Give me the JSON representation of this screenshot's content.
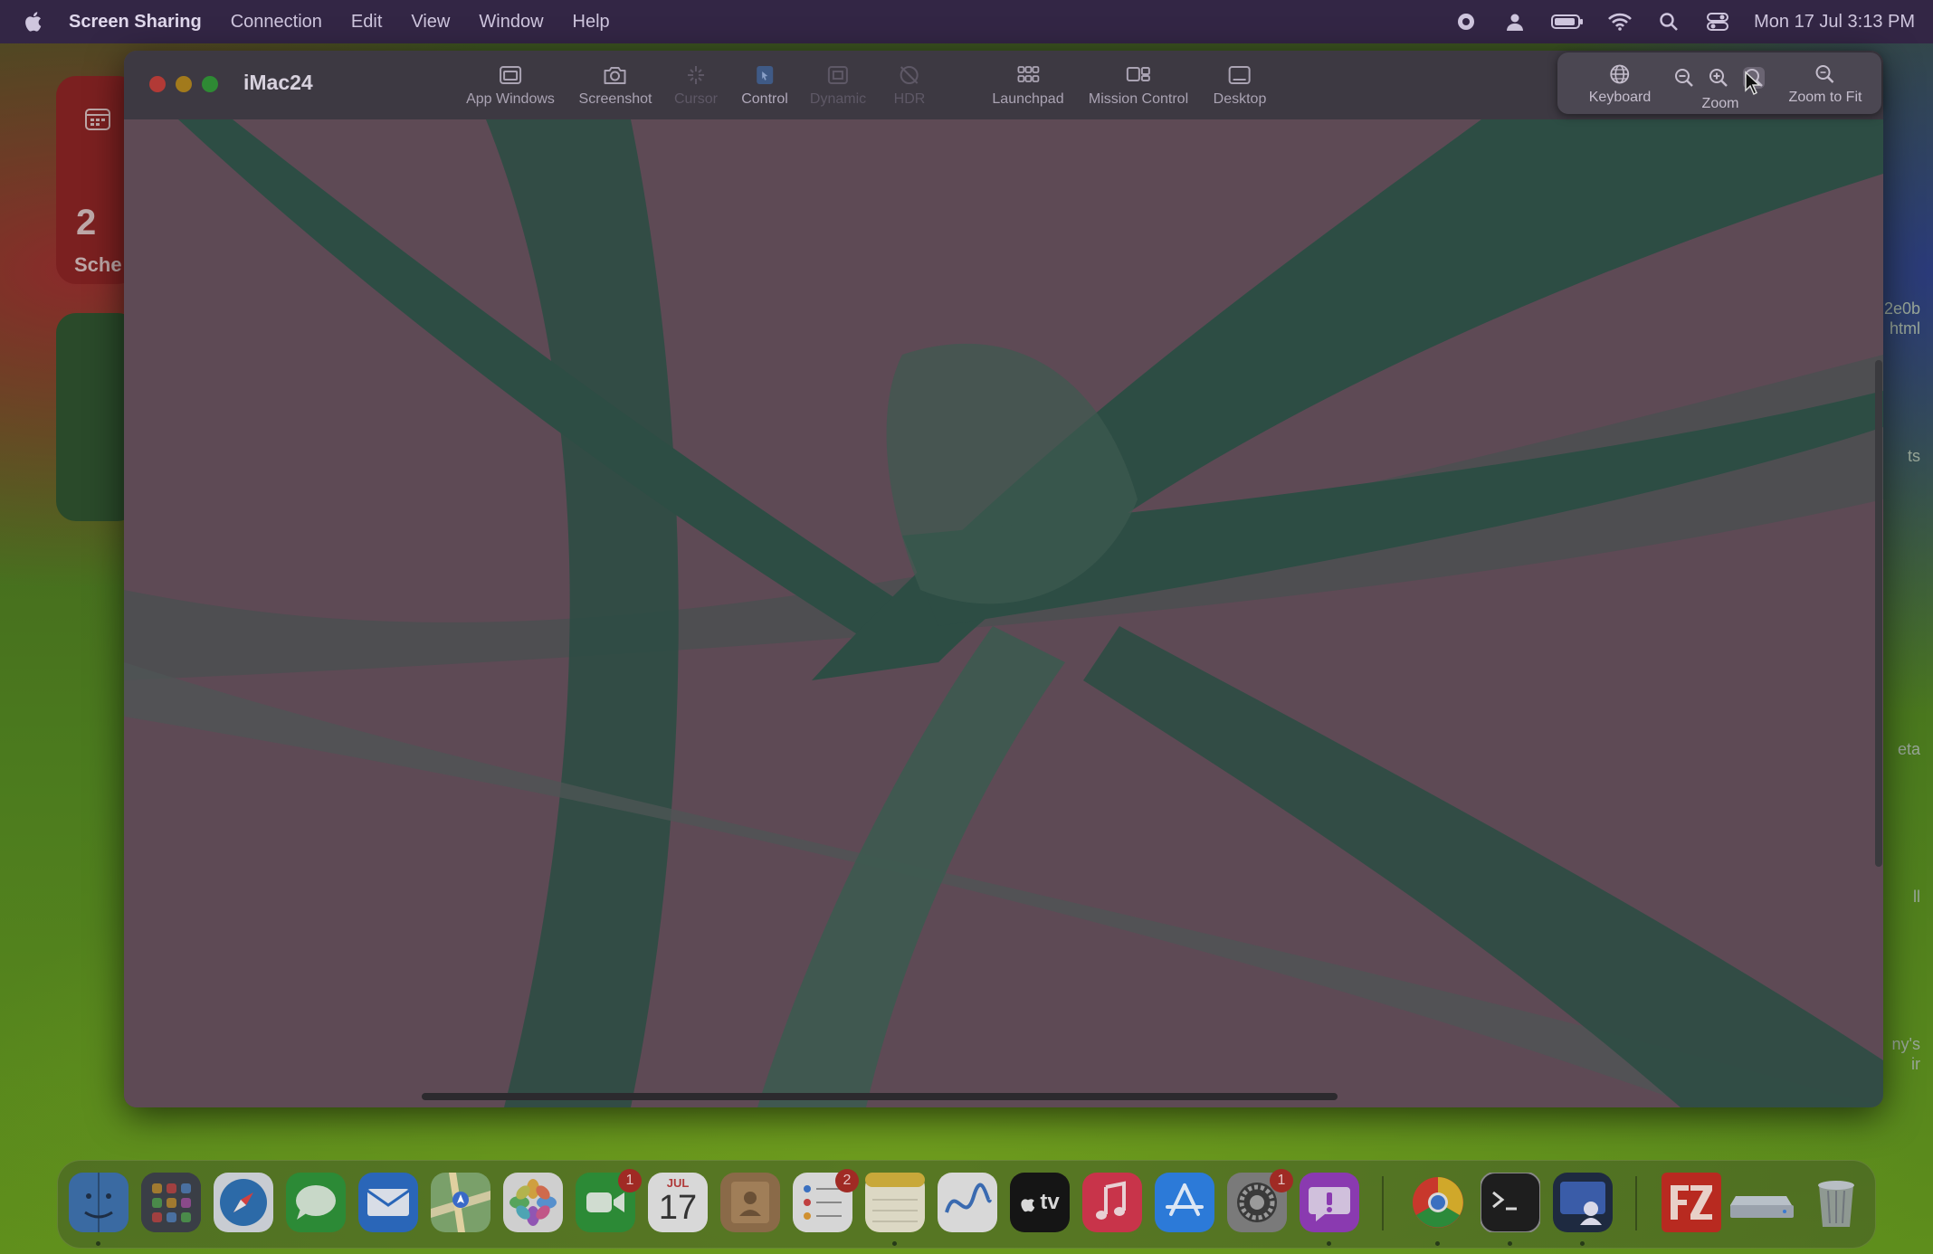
{
  "menubar": {
    "app_name": "Screen Sharing",
    "menus": [
      "Connection",
      "Edit",
      "View",
      "Window",
      "Help"
    ],
    "clock": "Mon 17 Jul  3:13 PM"
  },
  "desktop": {
    "widget_number": "2",
    "widget_label": "Sche",
    "right_snippets": [
      "2e0b",
      "html",
      "ts",
      "eta",
      "ll",
      "ny's",
      "ir"
    ]
  },
  "window": {
    "title": "iMac24",
    "toolbar": [
      {
        "label": "App Windows",
        "icon": "app-windows-icon",
        "state": "normal"
      },
      {
        "label": "Screenshot",
        "icon": "camera-icon",
        "state": "normal"
      },
      {
        "label": "Cursor",
        "icon": "cursor-sparkle-icon",
        "state": "disabled"
      },
      {
        "label": "Control",
        "icon": "control-icon",
        "state": "active"
      },
      {
        "label": "Dynamic",
        "icon": "dynamic-icon",
        "state": "disabled"
      },
      {
        "label": "HDR",
        "icon": "hdr-icon",
        "state": "disabled"
      },
      {
        "label": "Launchpad",
        "icon": "launchpad-grid-icon",
        "state": "normal"
      },
      {
        "label": "Mission Control",
        "icon": "mission-control-icon",
        "state": "normal"
      },
      {
        "label": "Desktop",
        "icon": "desktop-icon",
        "state": "normal"
      }
    ],
    "zoom_popover": {
      "keyboard_label": "Keyboard",
      "zoom_label": "Zoom",
      "zoom_to_fit_label": "Zoom to Fit"
    }
  },
  "dock": {
    "apps": [
      "Finder",
      "Launchpad",
      "Safari",
      "Messages",
      "Mail",
      "Maps",
      "Photos",
      "FaceTime",
      "Calendar",
      "Contacts",
      "Reminders",
      "Notes",
      "Freeform",
      "TV",
      "Music",
      "App Store",
      "System Settings",
      "Feedback Assistant",
      "Chrome",
      "Terminal",
      "Screen Sharing",
      "FileZilla",
      "Drive",
      "Trash"
    ],
    "facetime_badge": "1",
    "reminders_badge": "2",
    "settings_badge": "1",
    "calendar_month": "JUL",
    "calendar_day": "17",
    "tv_label": "tv"
  },
  "colors": {
    "menubar_bg": "#332645",
    "window_bg": "#5a4650",
    "ribbon": "#2d4d44",
    "ribbon_light": "#3d5a50"
  }
}
